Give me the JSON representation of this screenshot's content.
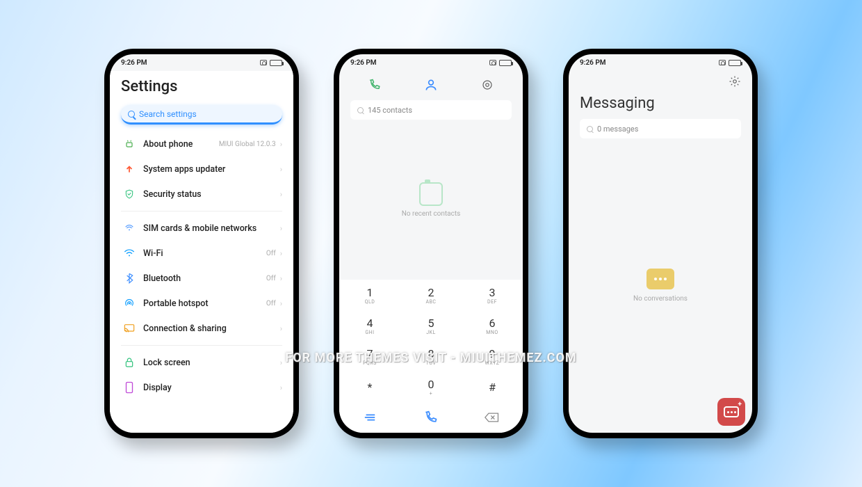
{
  "status": {
    "time": "9:26 PM"
  },
  "settings": {
    "title": "Settings",
    "search_placeholder": "Search settings",
    "groups": [
      [
        {
          "icon": "android",
          "color": "#4caf50",
          "label": "About phone",
          "trail": "MIUI Global 12.0.3"
        },
        {
          "icon": "arrow-up",
          "color": "#ff5a36",
          "label": "System apps updater",
          "trail": ""
        },
        {
          "icon": "shield",
          "color": "#30c27c",
          "label": "Security status",
          "trail": ""
        }
      ],
      [
        {
          "icon": "sim",
          "color": "#3a8cff",
          "label": "SIM cards & mobile networks",
          "trail": ""
        },
        {
          "icon": "wifi",
          "color": "#1aa3ff",
          "label": "Wi-Fi",
          "trail": "Off"
        },
        {
          "icon": "bluetooth",
          "color": "#3a8cff",
          "label": "Bluetooth",
          "trail": "Off"
        },
        {
          "icon": "hotspot",
          "color": "#1aa3ff",
          "label": "Portable hotspot",
          "trail": "Off"
        },
        {
          "icon": "cast",
          "color": "#f0a020",
          "label": "Connection & sharing",
          "trail": ""
        }
      ],
      [
        {
          "icon": "lock",
          "color": "#30c27c",
          "label": "Lock screen",
          "trail": ""
        },
        {
          "icon": "display",
          "color": "#c04bd8",
          "label": "Display",
          "trail": ""
        }
      ]
    ]
  },
  "dialer": {
    "search_text": "145 contacts",
    "empty_text": "No recent contacts",
    "keys": [
      [
        "1",
        "QLD"
      ],
      [
        "2",
        "ABC"
      ],
      [
        "3",
        "DEF"
      ],
      [
        "4",
        "GHI"
      ],
      [
        "5",
        "JKL"
      ],
      [
        "6",
        "MNO"
      ],
      [
        "7",
        "PQRS"
      ],
      [
        "8",
        "TUV"
      ],
      [
        "9",
        "WXYZ"
      ],
      [
        "*",
        ""
      ],
      [
        "0",
        "+"
      ],
      [
        "#",
        ""
      ]
    ]
  },
  "messaging": {
    "title": "Messaging",
    "search_text": "0 messages",
    "empty_text": "No conversations"
  },
  "watermark": "FOR MORE THEMES VISIT - MIUITHEMEZ.COM"
}
